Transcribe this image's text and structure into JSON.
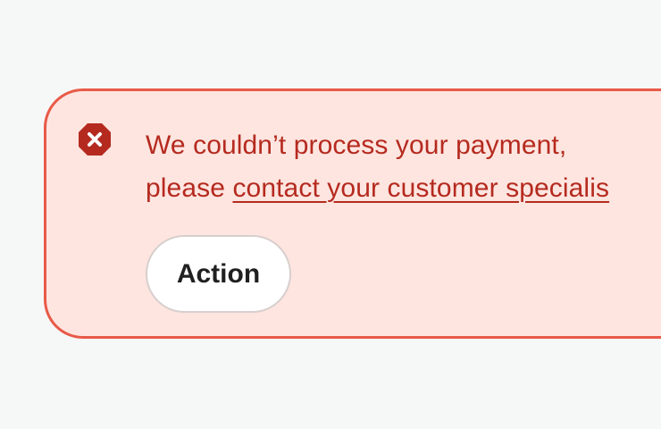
{
  "notice": {
    "type": "error",
    "message": {
      "line1": "We couldn’t process your payment,",
      "line2_prefix": "please ",
      "link_text": "contact your customer specialis"
    },
    "action_label": "Action",
    "icon": "error-icon"
  },
  "colors": {
    "page_background": "#f6f7f7",
    "banner_background": "#fee5e0",
    "banner_border": "#e85a47",
    "error_text": "#b52a1f",
    "error_icon": "#b52a1f",
    "button_background": "#ffffff",
    "button_text": "#202020"
  }
}
